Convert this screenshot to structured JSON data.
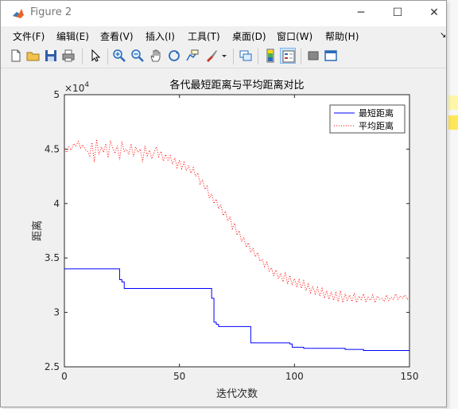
{
  "window": {
    "title": "Figure 2",
    "controls": {
      "minimize": "─",
      "maximize": "☐",
      "close": "✕"
    }
  },
  "menu": {
    "items": [
      "文件(F)",
      "编辑(E)",
      "查看(V)",
      "插入(I)",
      "工具(T)",
      "桌面(D)",
      "窗口(W)",
      "帮助(H)"
    ],
    "overflow_arrow": "↘"
  },
  "toolbar": {
    "icons": [
      "new-figure-icon",
      "open-file-icon",
      "save-icon",
      "print-icon",
      "edit-plot-arrow-icon",
      "zoom-in-icon",
      "zoom-out-icon",
      "pan-hand-icon",
      "rotate-3d-icon",
      "data-cursor-icon",
      "brush-icon",
      "brush-dropdown-icon",
      "link-plot-icon",
      "colorbar-icon",
      "legend-icon",
      "hide-plot-tools-icon",
      "show-plot-tools-icon"
    ]
  },
  "chart_data": {
    "type": "line",
    "title": "各代最短距离与平均距离对比",
    "xlabel": "迭代次数",
    "ylabel": "距离",
    "exponent_label": "×10",
    "exponent_power": "4",
    "xlim": [
      0,
      150
    ],
    "ylim": [
      2.5,
      5
    ],
    "xticks": [
      "0",
      "50",
      "100",
      "150"
    ],
    "yticks": [
      "2.5",
      "3",
      "3.5",
      "4",
      "4.5",
      "5"
    ],
    "legend_position": "top-right",
    "series": [
      {
        "name": "最短距离",
        "color": "#0000ff",
        "style": "solid",
        "step_points": [
          [
            0,
            3.4
          ],
          [
            24,
            3.4
          ],
          [
            24,
            3.3
          ],
          [
            25,
            3.3
          ],
          [
            25,
            3.28
          ],
          [
            26,
            3.28
          ],
          [
            26,
            3.22
          ],
          [
            64,
            3.22
          ],
          [
            64,
            3.13
          ],
          [
            65,
            3.13
          ],
          [
            65,
            2.91
          ],
          [
            66,
            2.91
          ],
          [
            66,
            2.89
          ],
          [
            67,
            2.89
          ],
          [
            67,
            2.87
          ],
          [
            81,
            2.87
          ],
          [
            81,
            2.72
          ],
          [
            98,
            2.72
          ],
          [
            98,
            2.71
          ],
          [
            99,
            2.71
          ],
          [
            99,
            2.68
          ],
          [
            104,
            2.68
          ],
          [
            104,
            2.67
          ],
          [
            122,
            2.67
          ],
          [
            122,
            2.66
          ],
          [
            130,
            2.66
          ],
          [
            130,
            2.65
          ],
          [
            150,
            2.65
          ]
        ]
      },
      {
        "name": "平均距离",
        "color": "#ff0000",
        "style": "dotted",
        "x": [
          0,
          1,
          2,
          3,
          4,
          5,
          6,
          7,
          8,
          9,
          10,
          11,
          12,
          13,
          14,
          15,
          16,
          17,
          18,
          19,
          20,
          21,
          22,
          23,
          24,
          25,
          26,
          27,
          28,
          29,
          30,
          31,
          32,
          33,
          34,
          35,
          36,
          37,
          38,
          39,
          40,
          41,
          42,
          43,
          44,
          45,
          46,
          47,
          48,
          49,
          50,
          51,
          52,
          53,
          54,
          55,
          56,
          57,
          58,
          59,
          60,
          61,
          62,
          63,
          64,
          65,
          66,
          67,
          68,
          69,
          70,
          71,
          72,
          73,
          74,
          75,
          76,
          77,
          78,
          79,
          80,
          81,
          82,
          83,
          84,
          85,
          86,
          87,
          88,
          89,
          90,
          91,
          92,
          93,
          94,
          95,
          96,
          97,
          98,
          99,
          100,
          101,
          102,
          103,
          104,
          105,
          106,
          107,
          108,
          109,
          110,
          111,
          112,
          113,
          114,
          115,
          116,
          117,
          118,
          119,
          120,
          121,
          122,
          123,
          124,
          125,
          126,
          127,
          128,
          129,
          130,
          131,
          132,
          133,
          134,
          135,
          136,
          137,
          138,
          139,
          140,
          141,
          142,
          143,
          144,
          145,
          146,
          147,
          148,
          149,
          150
        ],
        "y": [
          4.5,
          4.47,
          4.52,
          4.49,
          4.55,
          4.53,
          4.57,
          4.51,
          4.54,
          4.5,
          4.48,
          4.44,
          4.56,
          4.38,
          4.59,
          4.45,
          4.52,
          4.47,
          4.55,
          4.42,
          4.58,
          4.51,
          4.46,
          4.53,
          4.4,
          4.57,
          4.48,
          4.5,
          4.45,
          4.55,
          4.43,
          4.52,
          4.47,
          4.5,
          4.38,
          4.53,
          4.44,
          4.49,
          4.41,
          4.47,
          4.52,
          4.43,
          4.48,
          4.39,
          4.45,
          4.4,
          4.44,
          4.36,
          4.42,
          4.33,
          4.4,
          4.32,
          4.38,
          4.3,
          4.35,
          4.28,
          4.33,
          4.25,
          4.28,
          4.18,
          4.22,
          4.13,
          4.16,
          4.05,
          4.09,
          4.0,
          4.04,
          3.95,
          3.99,
          3.89,
          3.93,
          3.84,
          3.88,
          3.77,
          3.82,
          3.71,
          3.75,
          3.65,
          3.69,
          3.6,
          3.64,
          3.55,
          3.59,
          3.51,
          3.55,
          3.47,
          3.49,
          3.42,
          3.46,
          3.38,
          3.41,
          3.34,
          3.39,
          3.31,
          3.36,
          3.28,
          3.37,
          3.26,
          3.34,
          3.25,
          3.31,
          3.24,
          3.3,
          3.22,
          3.29,
          3.2,
          3.26,
          3.18,
          3.24,
          3.17,
          3.23,
          3.15,
          3.22,
          3.13,
          3.2,
          3.12,
          3.19,
          3.11,
          3.18,
          3.1,
          3.2,
          3.09,
          3.17,
          3.11,
          3.16,
          3.1,
          3.18,
          3.09,
          3.15,
          3.12,
          3.17,
          3.1,
          3.14,
          3.11,
          3.16,
          3.09,
          3.15,
          3.12,
          3.13,
          3.1,
          3.16,
          3.11,
          3.14,
          3.12,
          3.17,
          3.12,
          3.15,
          3.13,
          3.16,
          3.12,
          3.14
        ]
      }
    ]
  }
}
